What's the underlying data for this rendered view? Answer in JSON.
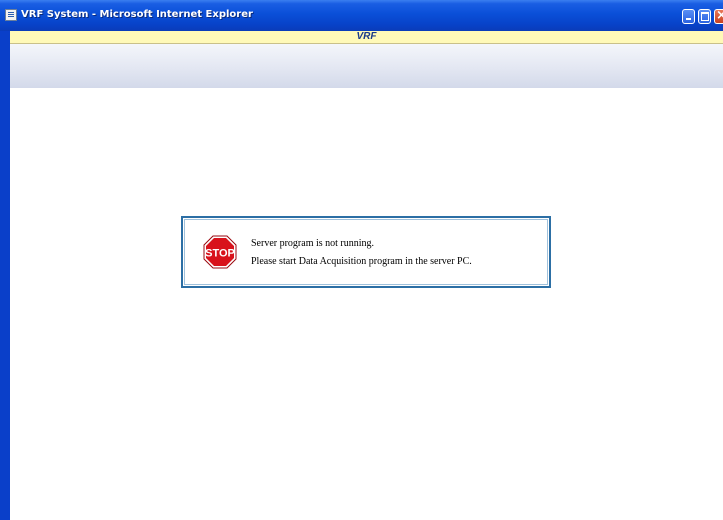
{
  "window": {
    "title": "VRF System - Microsoft Internet Explorer"
  },
  "page": {
    "header_label": "VRF"
  },
  "message": {
    "icon": "stop-sign-icon",
    "icon_text": "STOP",
    "line1": "Server program is not running.",
    "line2": "Please start Data Acquisition program in the server PC."
  },
  "colors": {
    "title_bar": "#0a4fd8",
    "header_bar": "#fff9b8",
    "message_border": "#2c6fa5",
    "stop_red": "#d8121b"
  }
}
